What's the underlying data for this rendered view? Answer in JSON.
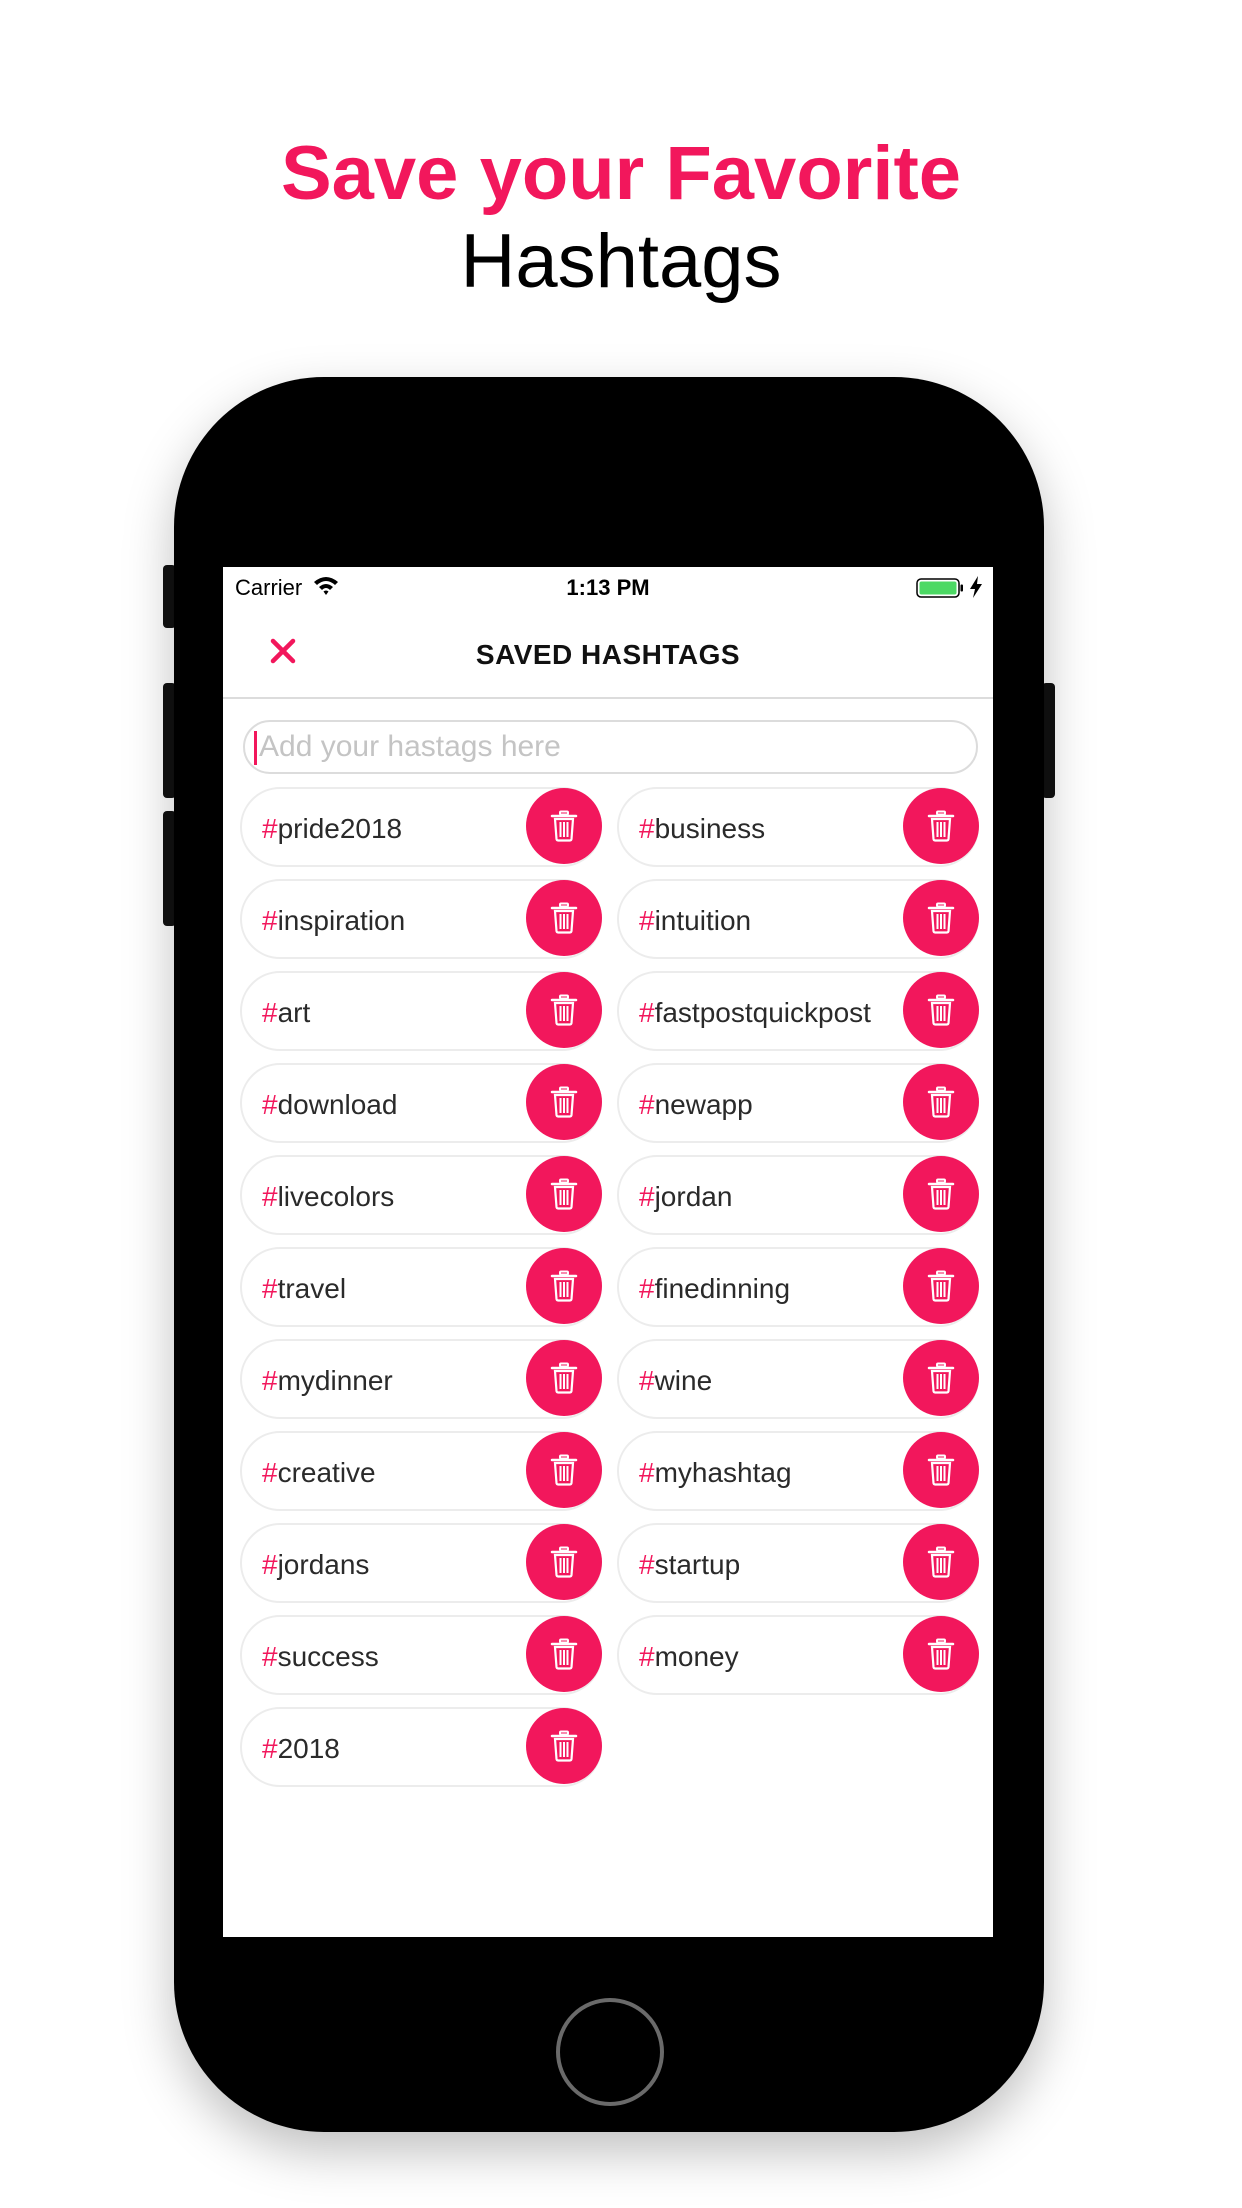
{
  "promo": {
    "line1": "Save your Favorite",
    "line2": "Hashtags"
  },
  "status_bar": {
    "carrier": "Carrier",
    "time": "1:13 PM"
  },
  "nav": {
    "title": "SAVED HASHTAGS"
  },
  "search": {
    "placeholder": "Add your hastags here",
    "value": ""
  },
  "hash_symbol": "#",
  "hashtags": [
    "pride2018",
    "business",
    "inspiration",
    "intuition",
    "art",
    "fastpostquickpost",
    "download",
    "newapp",
    "livecolors",
    "jordan",
    "travel",
    "finedinning",
    "mydinner",
    "wine",
    "creative",
    "myhashtag",
    "jordans",
    "startup",
    "success",
    "money",
    "2018"
  ],
  "icons": {
    "close": "close-icon",
    "delete": "trash-icon",
    "wifi": "wifi-icon",
    "battery": "battery-icon",
    "charge": "charging-bolt-icon"
  },
  "colors": {
    "accent": "#f2175c",
    "battery": "#4cd964",
    "phone": "#000000"
  }
}
